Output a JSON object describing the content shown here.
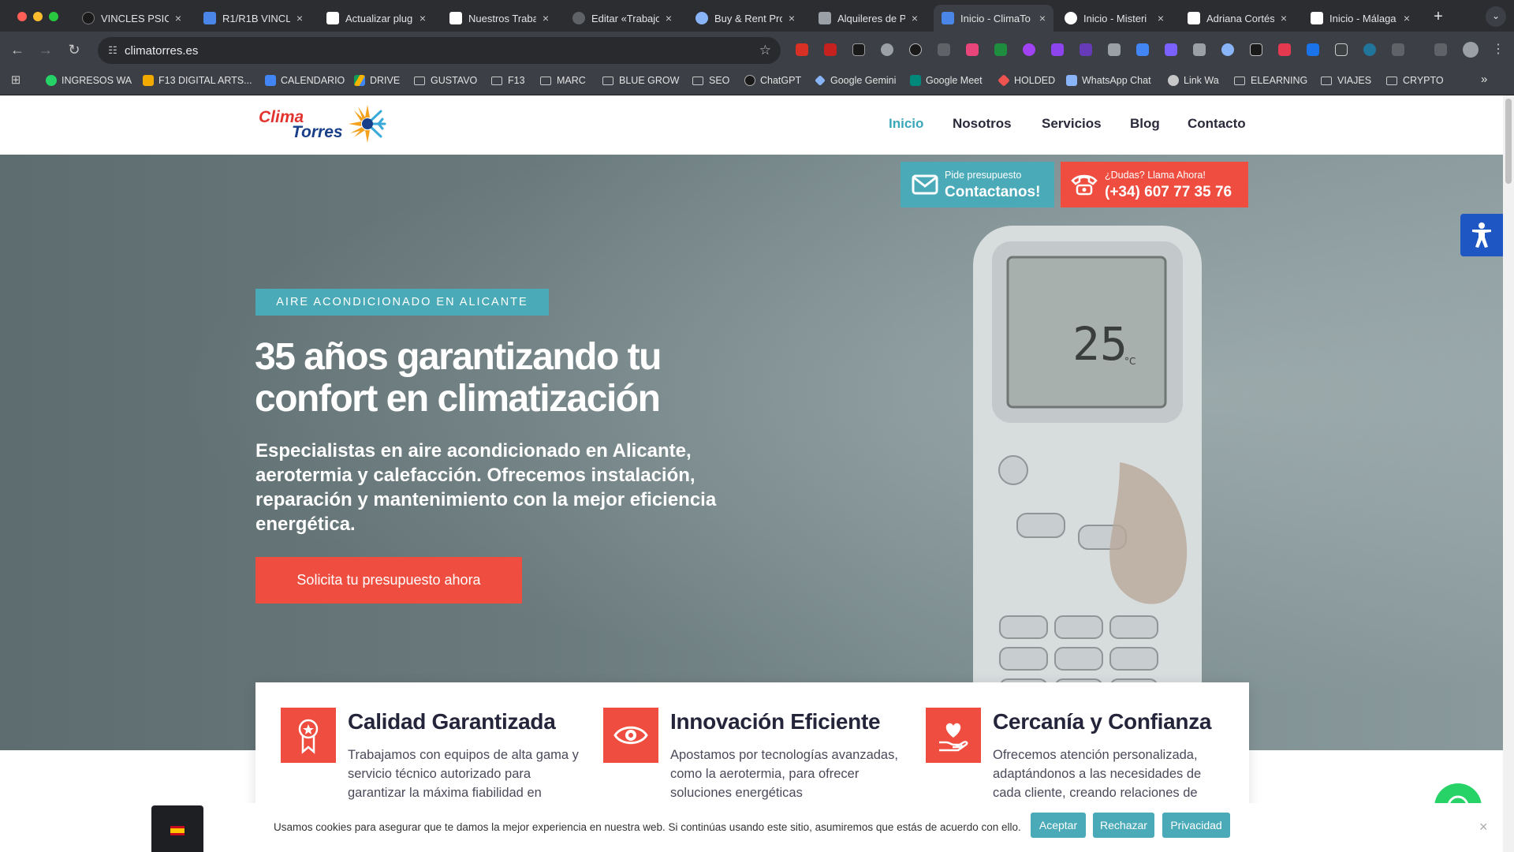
{
  "browser": {
    "tabs": [
      {
        "title": "VINCLES PSICO",
        "favicon_color": "#1a1a1a"
      },
      {
        "title": "R1/R1B VINCLE",
        "favicon_color": "#4a86e8"
      },
      {
        "title": "Actualizar plug",
        "favicon_color": "#ffffff"
      },
      {
        "title": "Nuestros Traba",
        "favicon_color": "#ffffff"
      },
      {
        "title": "Editar «Trabajo",
        "favicon_color": "#5f6368"
      },
      {
        "title": "Buy & Rent Pro",
        "favicon_color": "#8ab4f8"
      },
      {
        "title": "Alquileres de P",
        "favicon_color": "#9aa0a6"
      },
      {
        "title": "Inicio - ClimaTo",
        "favicon_color": "#4a86e8"
      },
      {
        "title": "Inicio - Misteri",
        "favicon_color": "#ffffff"
      },
      {
        "title": "Adriana Cortés",
        "favicon_color": "#ffffff"
      },
      {
        "title": "Inicio - Málaga",
        "favicon_color": "#ffffff"
      }
    ],
    "new_tab": "+",
    "url": "climatorres.es",
    "bookmarks": [
      {
        "label": "INGRESOS WA",
        "kind": "icon",
        "color": "#25d366"
      },
      {
        "label": "F13 DIGITAL ARTS...",
        "kind": "icon",
        "color": "#f2a900"
      },
      {
        "label": "CALENDARIO",
        "kind": "icon",
        "color": "#4285f4"
      },
      {
        "label": "DRIVE",
        "kind": "icon",
        "color": "#0f9d58"
      },
      {
        "label": "GUSTAVO",
        "kind": "folder"
      },
      {
        "label": "F13",
        "kind": "folder"
      },
      {
        "label": "MARC",
        "kind": "folder"
      },
      {
        "label": "BLUE GROW",
        "kind": "folder"
      },
      {
        "label": "SEO",
        "kind": "folder"
      },
      {
        "label": "ChatGPT",
        "kind": "icon",
        "color": "#1a1a1a"
      },
      {
        "label": "Google Gemini",
        "kind": "icon",
        "color": "#8ab4f8"
      },
      {
        "label": "Google Meet",
        "kind": "icon",
        "color": "#00897b"
      },
      {
        "label": "HOLDED",
        "kind": "icon",
        "color": "#ef5350"
      },
      {
        "label": "WhatsApp Chat",
        "kind": "icon",
        "color": "#8ab4f8"
      },
      {
        "label": "Link Wa",
        "kind": "icon",
        "color": "#c7c7c7"
      },
      {
        "label": "ELEARNING",
        "kind": "folder"
      },
      {
        "label": "VIAJES",
        "kind": "folder"
      },
      {
        "label": "CRYPTO",
        "kind": "folder"
      }
    ],
    "bookmarks_overflow": "»"
  },
  "site": {
    "logo": {
      "line1": "Clima",
      "line2": "Torres"
    },
    "nav": [
      "Inicio",
      "Nosotros",
      "Servicios",
      "Blog",
      "Contacto"
    ],
    "cta_quote": {
      "small": "Pide presupuesto",
      "big": "Contactanos!"
    },
    "cta_call": {
      "small": "¿Dudas? Llama Ahora!",
      "big": "(+34) 607 77 35 76"
    },
    "hero": {
      "kicker": "AIRE ACONDICIONADO EN ALICANTE",
      "title": "35 años garantizando tu confort en climatización",
      "lead": "Especialistas en aire acondicionado en Alicante, aerotermia y calefacción. Ofrecemos instalación, reparación y mantenimiento con la mejor eficiencia energética.",
      "button": "Solicita tu presupuesto ahora"
    },
    "features": [
      {
        "icon": "award-ribbon-icon",
        "title": "Calidad Garantizada",
        "text": "Trabajamos con equipos de alta gama y servicio técnico autorizado para garantizar la máxima fiabilidad en"
      },
      {
        "icon": "eye-icon",
        "title": "Innovación Eficiente",
        "text": "Apostamos por tecnologías avanzadas, como la aerotermia, para ofrecer soluciones energéticas"
      },
      {
        "icon": "hand-heart-icon",
        "title": "Cercanía y Confianza",
        "text": "Ofrecemos atención personalizada, adaptándonos a las necesidades de cada cliente, creando relaciones de"
      }
    ],
    "cookie": {
      "text": "Usamos cookies para asegurar que te damos la mejor experiencia en nuestra web. Si continúas usando este sitio, asumiremos que estás de acuerdo con ello.",
      "accept": "Aceptar",
      "reject": "Rechazar",
      "privacy": "Privacidad",
      "close": "×"
    },
    "colors": {
      "accent_teal": "#4aaab8",
      "accent_red": "#ee4d3f",
      "nav_active": "#3aa6b9",
      "whatsapp": "#27d367",
      "accessibility": "#1e57c4"
    }
  }
}
